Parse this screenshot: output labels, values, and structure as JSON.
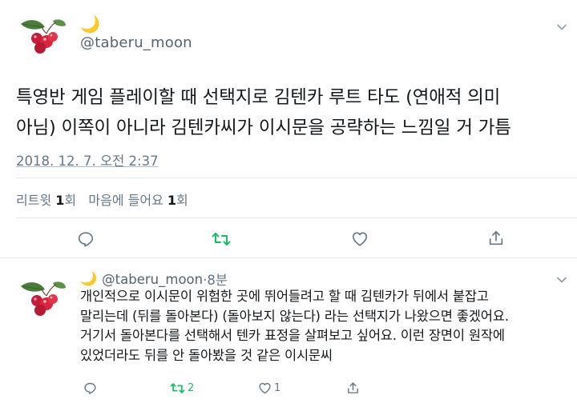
{
  "tweet": {
    "moon_emoji": "🌙",
    "handle": "@taberu_moon",
    "text_line1": "특영반 게임 플레이할 때 선택지로 김텐카 루트 타도 (연애적 의미",
    "text_line2": "아님) 이쪽이 아니라 김텐카씨가 이시문을 공략하는 느낌일 거 가틈",
    "timestamp": "2018. 12. 7. 오전 2:37",
    "stats": {
      "retweet_label": "리트윗",
      "retweet_count": "1",
      "retweet_unit": "회",
      "like_label": "마음에 들어요",
      "like_count": "1",
      "like_unit": "회"
    }
  },
  "reply": {
    "moon_emoji": "🌙",
    "handle": "@taberu_moon",
    "time": "·8분",
    "line1": "개인적으로 이시문이 위험한 곳에 뛰어들려고 할 때 김텐카가 뒤에서 붙잡고",
    "line2": "말리는데 (뒤를 돌아본다) (돌아보지 않는다) 라는 선택지가 나왔으면 좋겠어요.",
    "line3": "거기서 돌아본다를 선택해서 텐카 표정을 살펴보고 싶어요. 이런 장면이 원작에",
    "line4": "있었더라도 뒤를 안 돌아봤을 것 같은 이시문씨",
    "retweet_count": "2",
    "like_count": "1"
  },
  "icons": {
    "reply": "reply-icon",
    "retweet": "retweet-icon",
    "like": "heart-icon",
    "share": "share-icon",
    "menu": "chevron-down-icon",
    "avatar": "berry-avatar"
  },
  "colors": {
    "retweet_active": "#17bf63",
    "text_secondary": "#657786",
    "moon": "#f2c230",
    "berry": "#d7263d",
    "leaf": "#4a7c3a"
  }
}
